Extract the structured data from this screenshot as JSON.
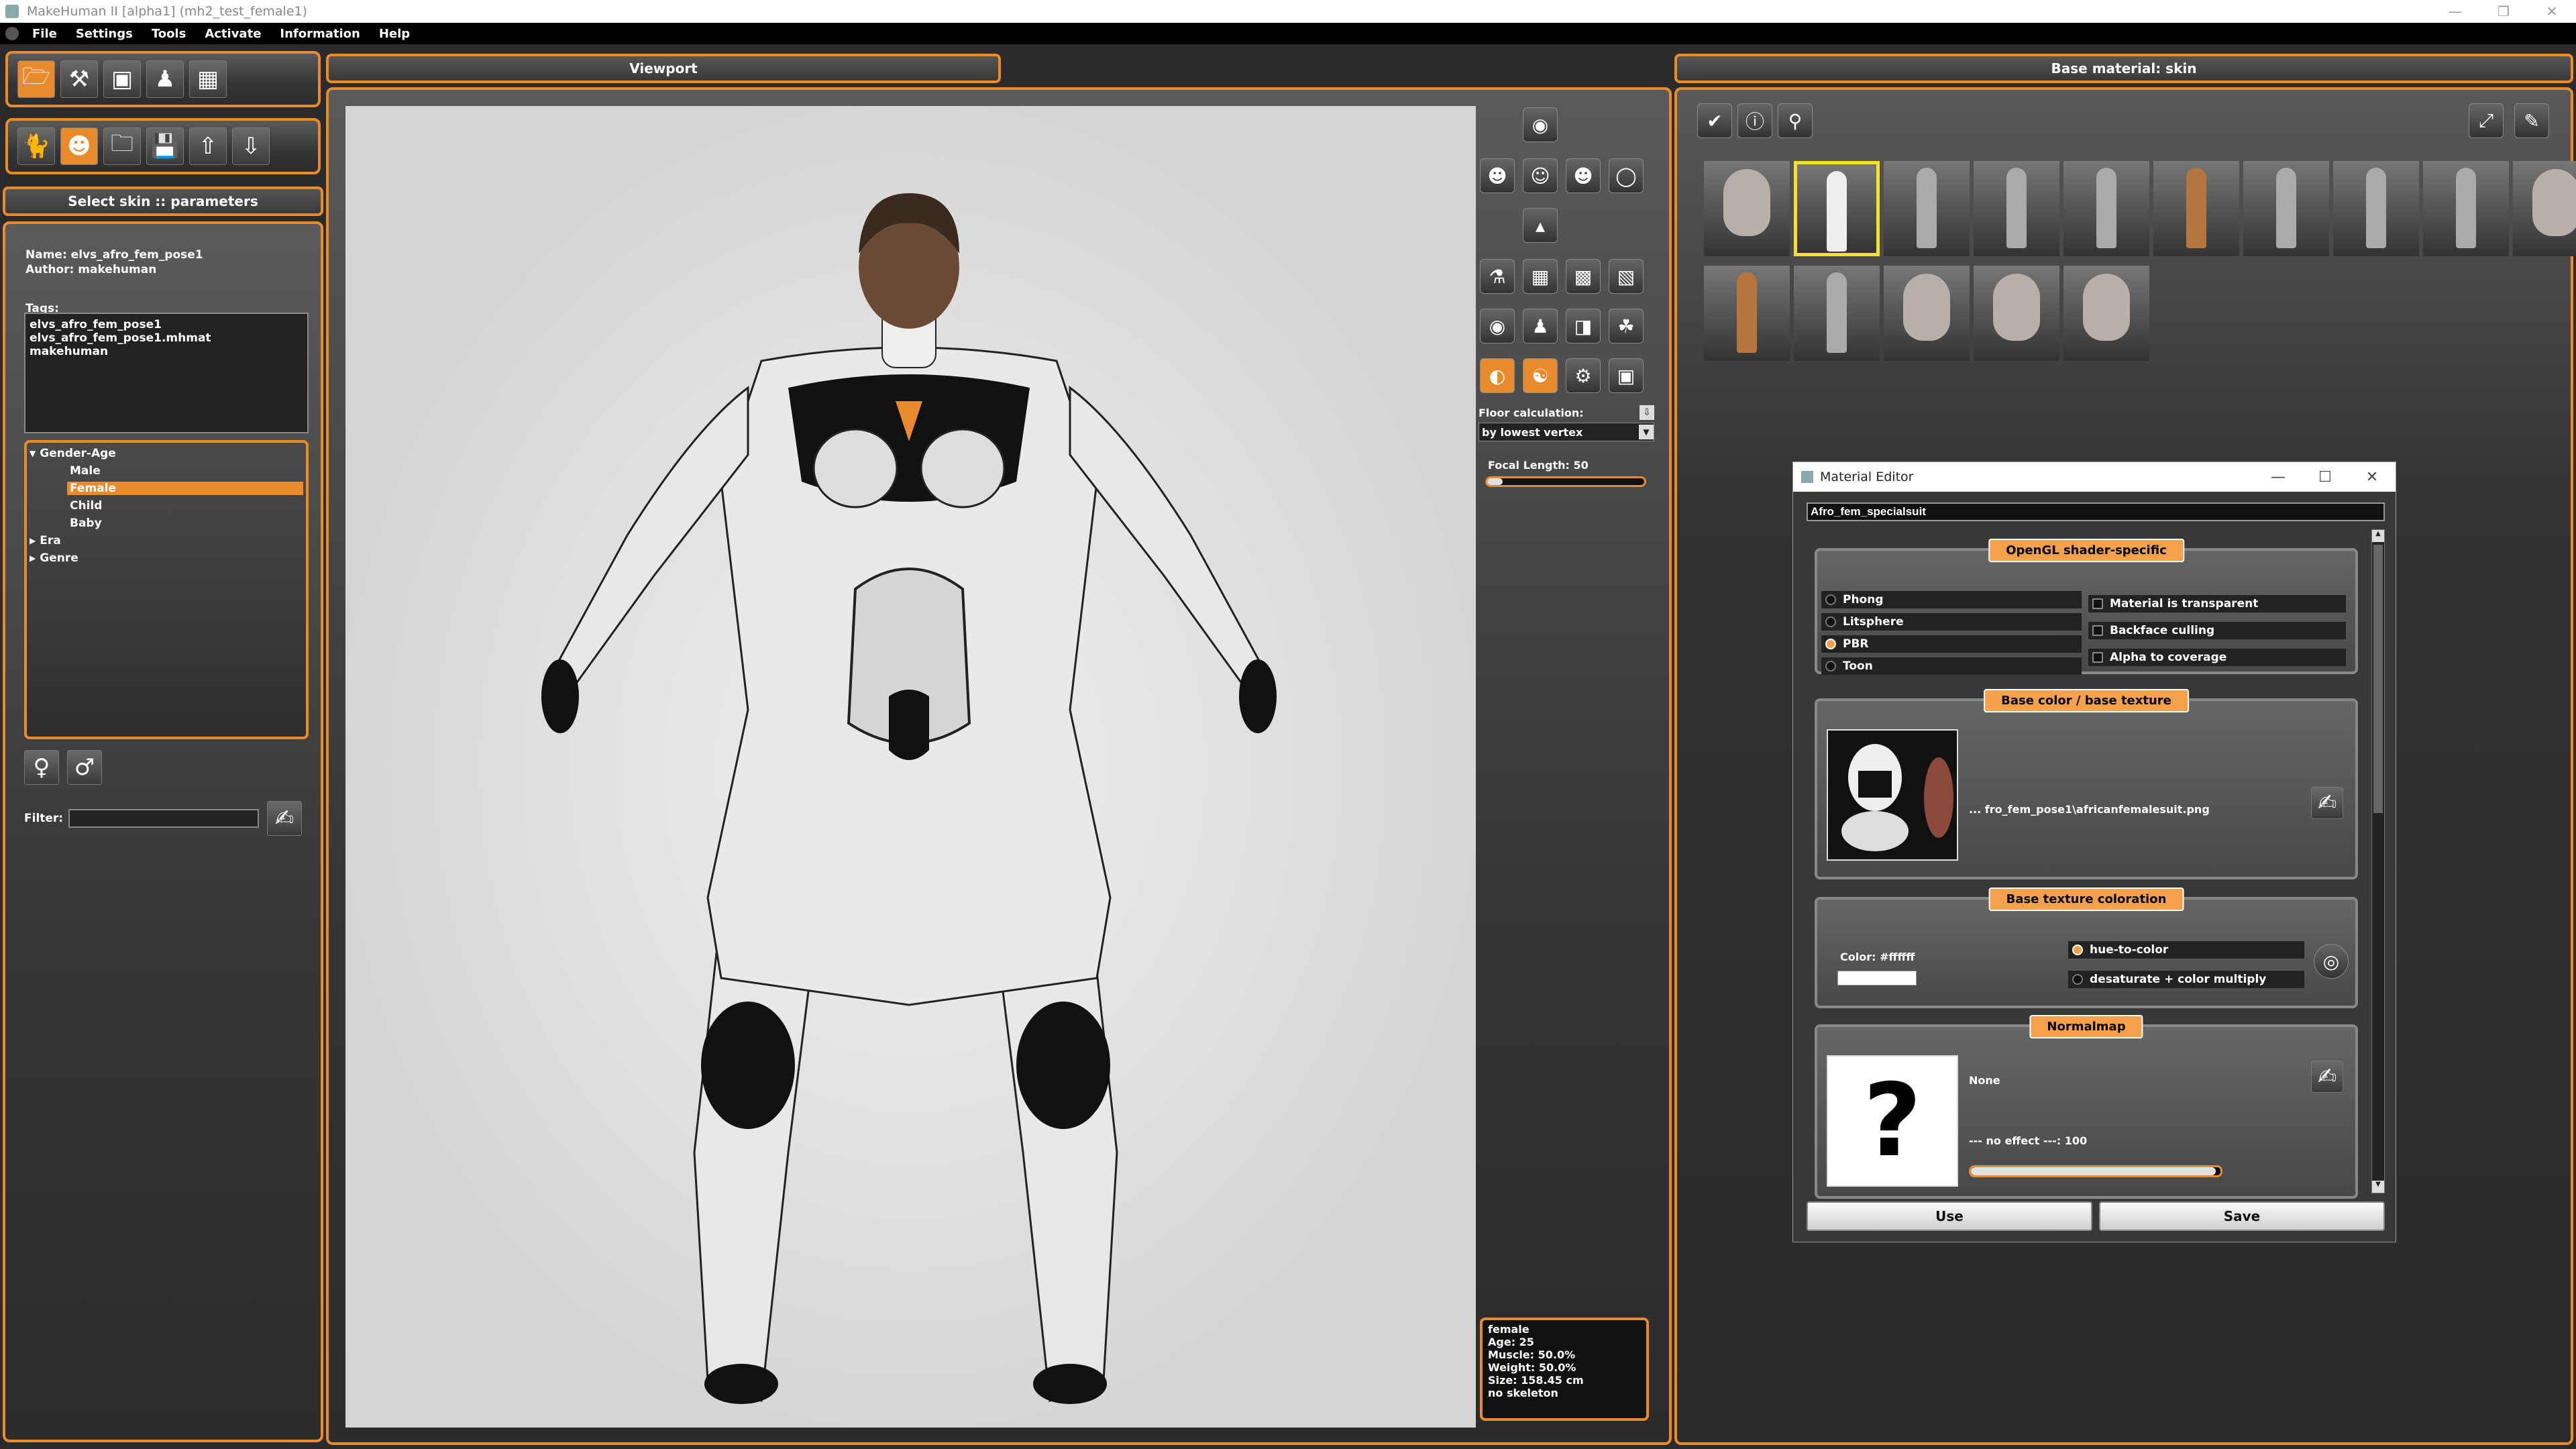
{
  "window": {
    "title": "MakeHuman II [alpha1]  (mh2_test_female1)",
    "controls": [
      "—",
      "❐",
      "✕"
    ]
  },
  "menu": [
    "File",
    "Settings",
    "Tools",
    "Activate",
    "Information",
    "Help"
  ],
  "left": {
    "panel_title": "Select skin :: parameters",
    "name_line": "Name: elvs_afro_fem_pose1",
    "author_line": "Author: makehuman",
    "tags_label": "Tags:",
    "tags": [
      "elvs_afro_fem_pose1",
      "elvs_afro_fem_pose1.mhmat",
      "makehuman"
    ],
    "tree": {
      "root": "Gender-Age",
      "children": [
        "Male",
        "Female",
        "Child",
        "Baby"
      ],
      "selected": "Female",
      "others": [
        "Era",
        "Genre"
      ]
    },
    "filter_label": "Filter:",
    "filter_value": ""
  },
  "viewport": {
    "title": "Viewport",
    "floor_label": "Floor calculation:",
    "floor_value": "by lowest vertex",
    "focal_label": "Focal Length: 50",
    "focal_fraction": 0.1,
    "info": [
      "female",
      "Age: 25",
      "Muscle: 50.0%",
      "Weight: 50.0%",
      "Size: 158.45 cm",
      "no skeleton"
    ]
  },
  "material": {
    "title": "Base material: skin",
    "thumbnail_count": 15,
    "selected_index": 1
  },
  "editor": {
    "title": "Material Editor",
    "controls": [
      "—",
      "☐",
      "✕"
    ],
    "name_value": "Afro_fem_specialsuit",
    "shader_label": "OpenGL shader-specific",
    "shaders": [
      "Phong",
      "Litsphere",
      "PBR",
      "Toon"
    ],
    "shader_selected": "PBR",
    "flags": [
      "Material is transparent",
      "Backface culling",
      "Alpha to coverage"
    ],
    "basecolor_label": "Base color / base texture",
    "basecolor_path": "... fro_fem_pose1\\africanfemalesuit.png",
    "coloration_label": "Base texture coloration",
    "color_label": "Color: #ffffff",
    "color_hex": "#ffffff",
    "color_modes": [
      "hue-to-color",
      "desaturate + color multiply"
    ],
    "color_mode_selected": "hue-to-color",
    "normalmap_label": "Normalmap",
    "normalmap_value": "None",
    "normalmap_effect": "--- no effect ---: 100",
    "normalmap_fraction": 0.98,
    "use_label": "Use",
    "save_label": "Save"
  },
  "colors": {
    "accent": "#e98a2c",
    "highlight": "#f5a04a",
    "selection_border": "#f5e12a"
  }
}
